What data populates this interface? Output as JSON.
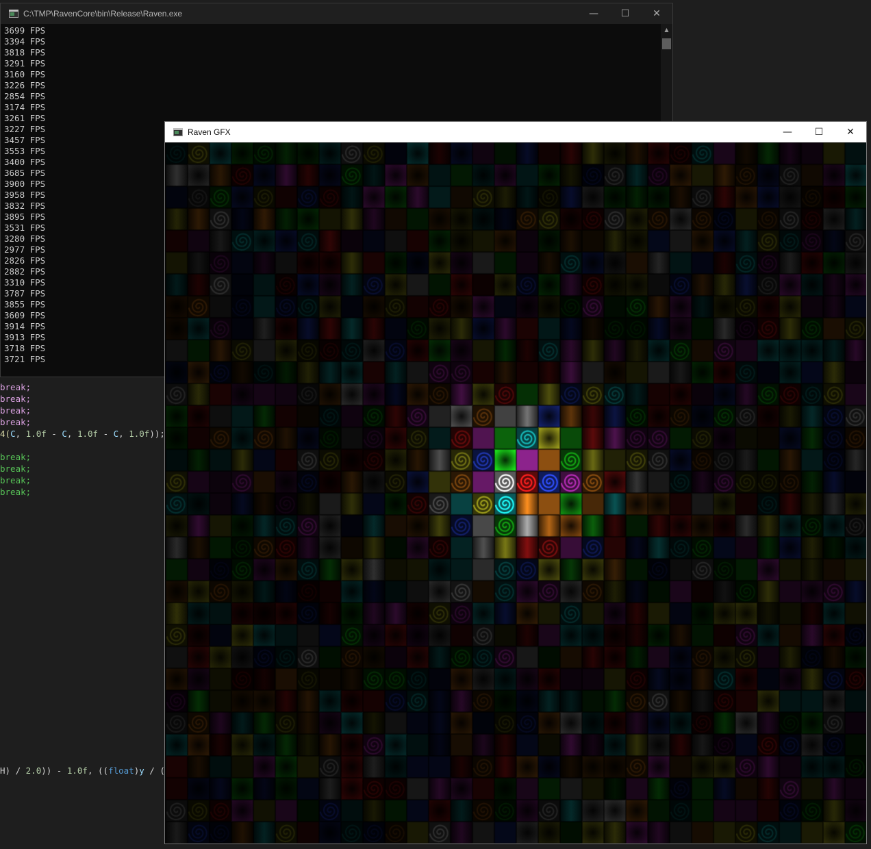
{
  "editor": {
    "lines": [
      {
        "tokens": [
          {
            "t": "break;",
            "c": "kw"
          }
        ]
      },
      {
        "tokens": [
          {
            "t": "break;",
            "c": "kw"
          }
        ]
      },
      {
        "tokens": [
          {
            "t": "break;",
            "c": "kw"
          }
        ]
      },
      {
        "tokens": [
          {
            "t": "break;",
            "c": "kw"
          }
        ]
      },
      {
        "tokens": [
          {
            "t": "4(",
            "c": "fn"
          },
          {
            "t": "C",
            "c": "ident"
          },
          {
            "t": ", ",
            "c": "op"
          },
          {
            "t": "1.0f",
            "c": "num"
          },
          {
            "t": " - ",
            "c": "op"
          },
          {
            "t": "C",
            "c": "ident"
          },
          {
            "t": ", ",
            "c": "op"
          },
          {
            "t": "1.0f",
            "c": "num"
          },
          {
            "t": " - ",
            "c": "op"
          },
          {
            "t": "C",
            "c": "ident"
          },
          {
            "t": ", ",
            "c": "op"
          },
          {
            "t": "1.0f",
            "c": "num"
          },
          {
            "t": "));",
            "c": "op"
          }
        ]
      },
      {
        "tokens": [
          {
            "t": "",
            "c": "op"
          }
        ]
      },
      {
        "tokens": [
          {
            "t": "break;",
            "c": "kw-green"
          }
        ]
      },
      {
        "tokens": [
          {
            "t": "break;",
            "c": "kw-green"
          }
        ]
      },
      {
        "tokens": [
          {
            "t": "break;",
            "c": "kw-green"
          }
        ]
      },
      {
        "tokens": [
          {
            "t": "break;",
            "c": "kw-green"
          }
        ]
      }
    ],
    "bottom_line": {
      "tokens": [
        {
          "t": "H) / ",
          "c": "op"
        },
        {
          "t": "2.0",
          "c": "num"
        },
        {
          "t": ")) - ",
          "c": "op"
        },
        {
          "t": "1.0f",
          "c": "num"
        },
        {
          "t": ", ((",
          "c": "op"
        },
        {
          "t": "float",
          "c": "type"
        },
        {
          "t": ")",
          "c": "op"
        },
        {
          "t": "y",
          "c": "ident"
        },
        {
          "t": " / (",
          "c": "op"
        }
      ]
    }
  },
  "console": {
    "title": "C:\\TMP\\RavenCore\\bin\\Release\\Raven.exe",
    "minimize_glyph": "—",
    "maximize_glyph": "☐",
    "close_glyph": "✕",
    "lines": [
      "3699 FPS",
      "3394 FPS",
      "3818 FPS",
      "3291 FPS",
      "3160 FPS",
      "3226 FPS",
      "2854 FPS",
      "3174 FPS",
      "3261 FPS",
      "3227 FPS",
      "3457 FPS",
      "3553 FPS",
      "3400 FPS",
      "3685 FPS",
      "3900 FPS",
      "3958 FPS",
      "3832 FPS",
      "3895 FPS",
      "3531 FPS",
      "3280 FPS",
      "2977 FPS",
      "2826 FPS",
      "2882 FPS",
      "3310 FPS",
      "3787 FPS",
      "3855 FPS",
      "3609 FPS",
      "3914 FPS",
      "3913 FPS",
      "3718 FPS",
      "3721 FPS"
    ]
  },
  "gfx": {
    "title": "Raven GFX",
    "minimize_glyph": "—",
    "maximize_glyph": "☐",
    "close_glyph": "✕",
    "palette": [
      "#ff2020",
      "#20ff20",
      "#3050ff",
      "#ffff30",
      "#ff40ff",
      "#20ffff",
      "#ffffff",
      "#ff9020"
    ]
  }
}
